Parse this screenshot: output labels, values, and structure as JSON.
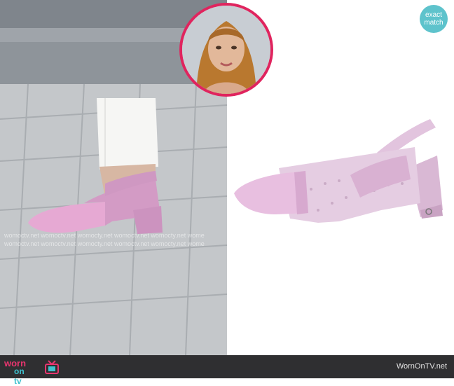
{
  "badge": {
    "line1": "exact",
    "line2": "match",
    "color": "#5ec3cc"
  },
  "watermark": {
    "line1": "womoctv.net womoctv.net womocty.net womoctv.net womocty.net wome",
    "line2": "womoctv.net womoctv.net womocty.net womoctv.net womocty.net wome"
  },
  "footer": {
    "logo_top": "worn",
    "logo_bottom": "on tv",
    "site": "WornOnTV.net"
  },
  "colors": {
    "accent_pink": "#e0245e",
    "accent_teal": "#3fc2cf",
    "footer_bg": "#2f2f31"
  },
  "icons": [
    "tv-icon"
  ]
}
